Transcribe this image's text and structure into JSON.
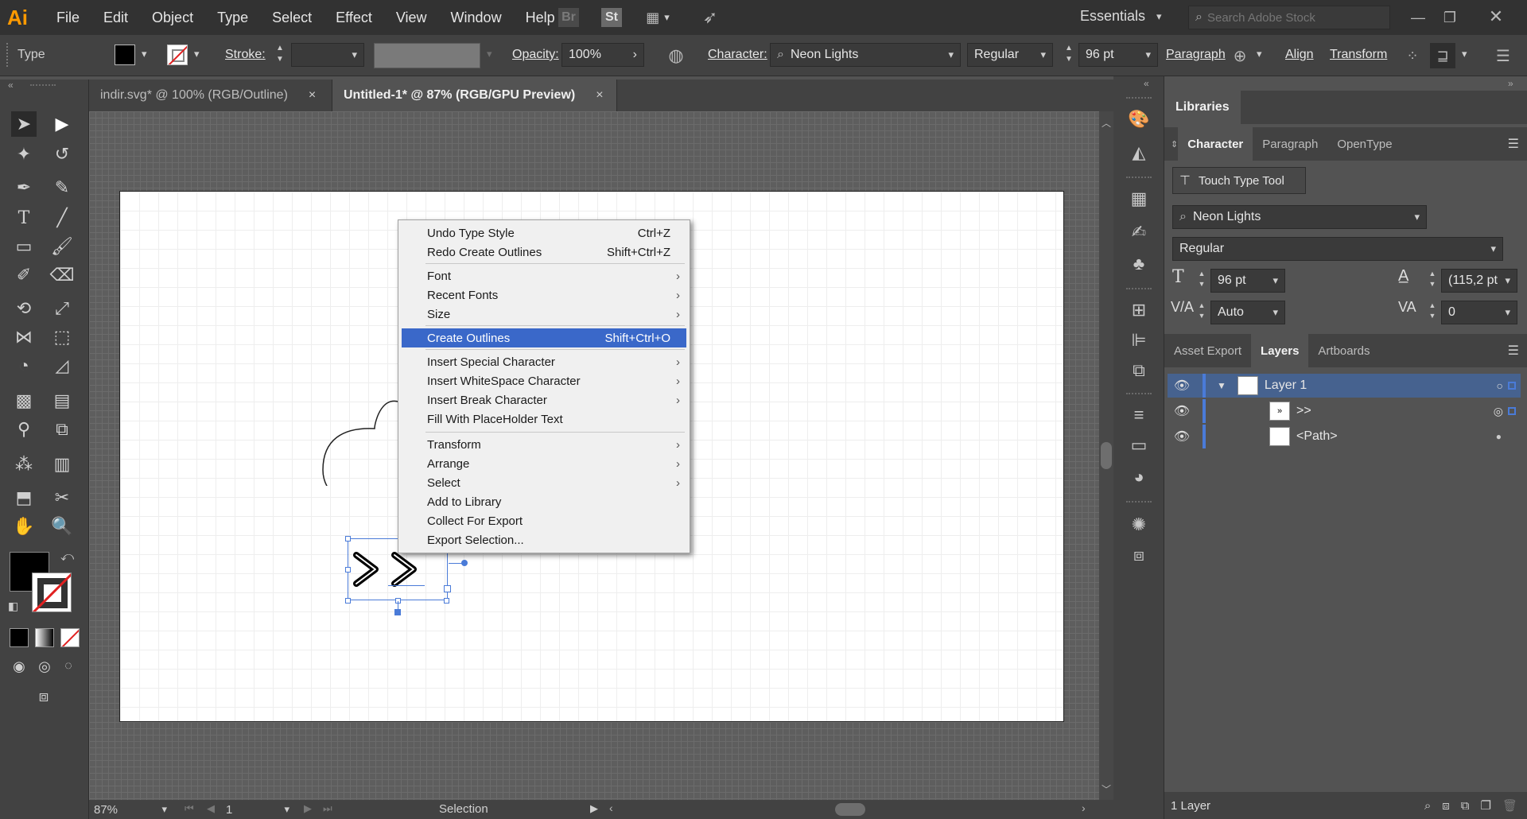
{
  "app": {
    "logo": "Ai"
  },
  "menu": [
    "File",
    "Edit",
    "Object",
    "Type",
    "Select",
    "Effect",
    "View",
    "Window",
    "Help"
  ],
  "topbar": {
    "bridge": "Br",
    "stock": "St",
    "workspace": "Essentials",
    "search_placeholder": "Search Adobe Stock"
  },
  "control": {
    "tool_name": "Type",
    "stroke_label": "Stroke:",
    "opacity_label": "Opacity:",
    "opacity_value": "100%",
    "character_label": "Character:",
    "font": "Neon Lights",
    "style": "Regular",
    "size": "96 pt",
    "paragraph_label": "Paragraph",
    "align_label": "Align",
    "transform_label": "Transform"
  },
  "tabs": [
    {
      "label": "indir.svg* @ 100% (RGB/Outline)",
      "close": "×"
    },
    {
      "label": "Untitled-1* @ 87% (RGB/GPU Preview)",
      "close": "×"
    }
  ],
  "canvas": {
    "text": ">>"
  },
  "context_menu": [
    {
      "label": "Undo Type Style",
      "shortcut": "Ctrl+Z"
    },
    {
      "label": "Redo Create Outlines",
      "shortcut": "Shift+Ctrl+Z"
    },
    {
      "label": "Font",
      "submenu": "›"
    },
    {
      "label": "Recent Fonts",
      "submenu": "›"
    },
    {
      "label": "Size",
      "submenu": "›"
    },
    {
      "label": "Create Outlines",
      "shortcut": "Shift+Ctrl+O"
    },
    {
      "label": "Insert Special Character",
      "submenu": "›"
    },
    {
      "label": "Insert WhiteSpace Character",
      "submenu": "›"
    },
    {
      "label": "Insert Break Character",
      "submenu": "›"
    },
    {
      "label": "Fill With PlaceHolder Text"
    },
    {
      "label": "Transform",
      "submenu": "›"
    },
    {
      "label": "Arrange",
      "submenu": "›"
    },
    {
      "label": "Select",
      "submenu": "›"
    },
    {
      "label": "Add to Library"
    },
    {
      "label": "Collect For Export"
    },
    {
      "label": "Export Selection..."
    }
  ],
  "status": {
    "zoom": "87%",
    "artboard": "1",
    "mode": "Selection"
  },
  "libraries": {
    "tab": "Libraries"
  },
  "character_panel": {
    "tabs": [
      "Character",
      "Paragraph",
      "OpenType"
    ],
    "touch_type": "Touch Type Tool",
    "font": "Neon Lights",
    "style": "Regular",
    "size": "96 pt",
    "leading": "(115,2 pt",
    "kerning": "Auto",
    "tracking": "0"
  },
  "layers_panel": {
    "tabs": [
      "Asset Export",
      "Layers",
      "Artboards"
    ],
    "rows": [
      {
        "name": "Layer 1"
      },
      {
        "name": ">>"
      },
      {
        "name": "<Path>"
      }
    ],
    "footer": "1 Layer"
  }
}
